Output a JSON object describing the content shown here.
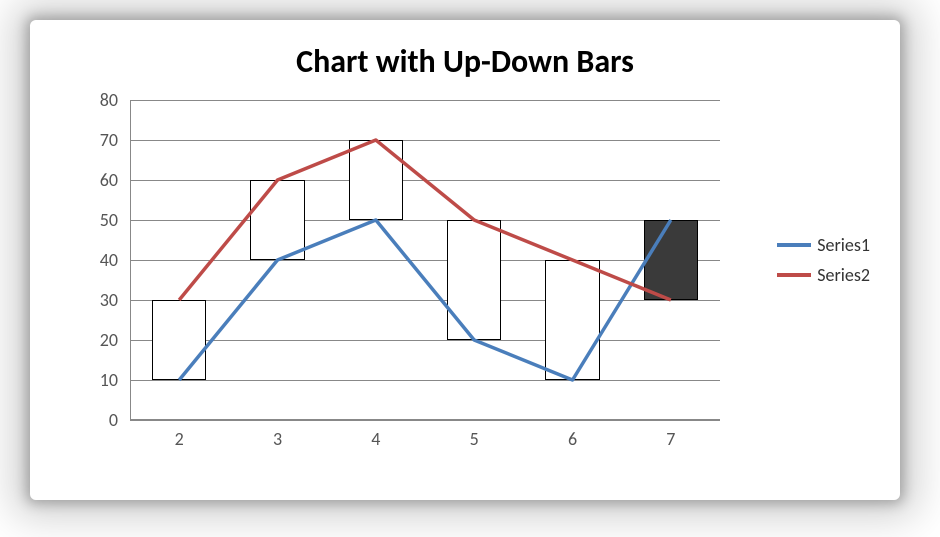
{
  "chart_data": {
    "type": "line",
    "title": "Chart with Up-Down Bars",
    "xlabel": "",
    "ylabel": "",
    "categories": [
      2,
      3,
      4,
      5,
      6,
      7
    ],
    "ylim": [
      0,
      80
    ],
    "yticks": [
      0,
      10,
      20,
      30,
      40,
      50,
      60,
      70,
      80
    ],
    "series": [
      {
        "name": "Series1",
        "color": "#4a7ebb",
        "values": [
          10,
          40,
          50,
          20,
          10,
          50
        ]
      },
      {
        "name": "Series2",
        "color": "#be4b48",
        "values": [
          30,
          60,
          70,
          50,
          40,
          30
        ]
      }
    ],
    "updown_bars": {
      "up_fill": "#ffffff",
      "down_fill": "#3a3a3a",
      "border": "#000000"
    },
    "legend_position": "right"
  },
  "legend": {
    "items": [
      {
        "label": "Series1"
      },
      {
        "label": "Series2"
      }
    ]
  }
}
